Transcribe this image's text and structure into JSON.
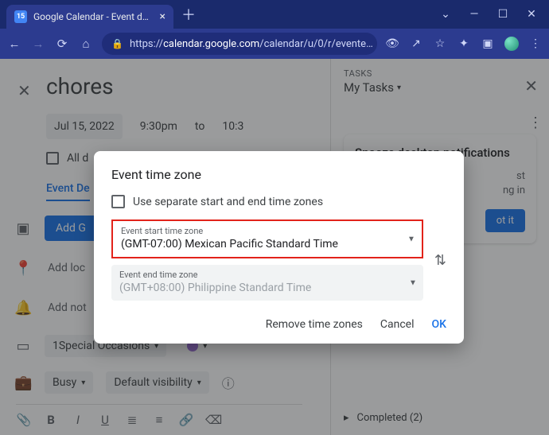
{
  "browser": {
    "tab_title": "Google Calendar - Event details",
    "url_host": "calendar.google.com",
    "url_prefix": "https://",
    "url_path": "/calendar/u/0/r/evente…"
  },
  "event": {
    "title": "chores",
    "date": "Jul 15, 2022",
    "start_time": "9:30pm",
    "to_label": "to",
    "end_time": "10:3",
    "all_day_label": "All d",
    "tab_selected": "Event De",
    "add_meet_btn": "Add G",
    "add_location": "Add loc",
    "add_notification": "Add not",
    "calendar_label": "1Special Occasions",
    "busy_label": "Busy",
    "visibility_label": "Default visibility"
  },
  "side": {
    "tasks_label": "TASKS",
    "list_name": "My Tasks",
    "snooze_title": "Snooze desktop notifications",
    "snooze_body_1": "st",
    "snooze_body_2": "ng in",
    "gotit": "ot it",
    "completed_label": "Completed (2)"
  },
  "dialog": {
    "title": "Event time zone",
    "separate_label": "Use separate start and end time zones",
    "start_label": "Event start time zone",
    "start_value": "(GMT-07:00) Mexican Pacific Standard Time",
    "end_label": "Event end time zone",
    "end_value": "(GMT+08:00) Philippine Standard Time",
    "remove": "Remove time zones",
    "cancel": "Cancel",
    "ok": "OK"
  }
}
